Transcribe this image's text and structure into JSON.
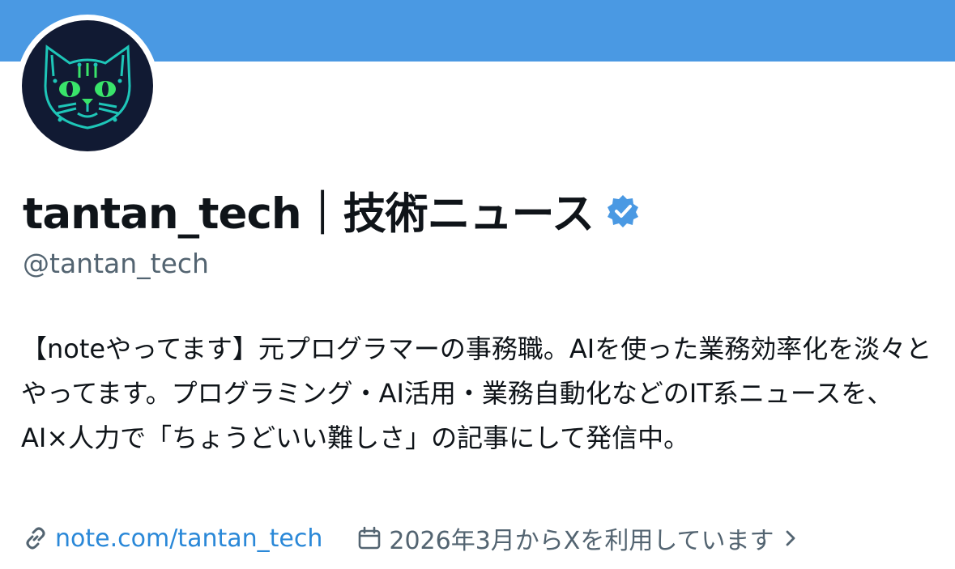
{
  "profile": {
    "display_name": "tantan_tech｜技術ニュース",
    "handle": "@tantan_tech",
    "bio": "【noteやってます】元プログラマーの事務職。AIを使った業務効率化を淡々とやってます。プログラミング・AI活用・業務自動化などのIT系ニュースを、AI×人力で「ちょうどいい難しさ」の記事にして発信中。",
    "link_text": "note.com/tantan_tech",
    "joined_text": "2026年3月からXを利用しています"
  },
  "icons": {
    "verified": "verified-badge-icon",
    "link": "link-icon",
    "calendar": "calendar-icon",
    "chevron": "chevron-right-icon"
  },
  "colors": {
    "banner": "#4a99e3",
    "accent": "#1d9bf0",
    "muted_text": "#536471",
    "avatar_bg": "#111a33",
    "avatar_glow": "#39e46a"
  }
}
